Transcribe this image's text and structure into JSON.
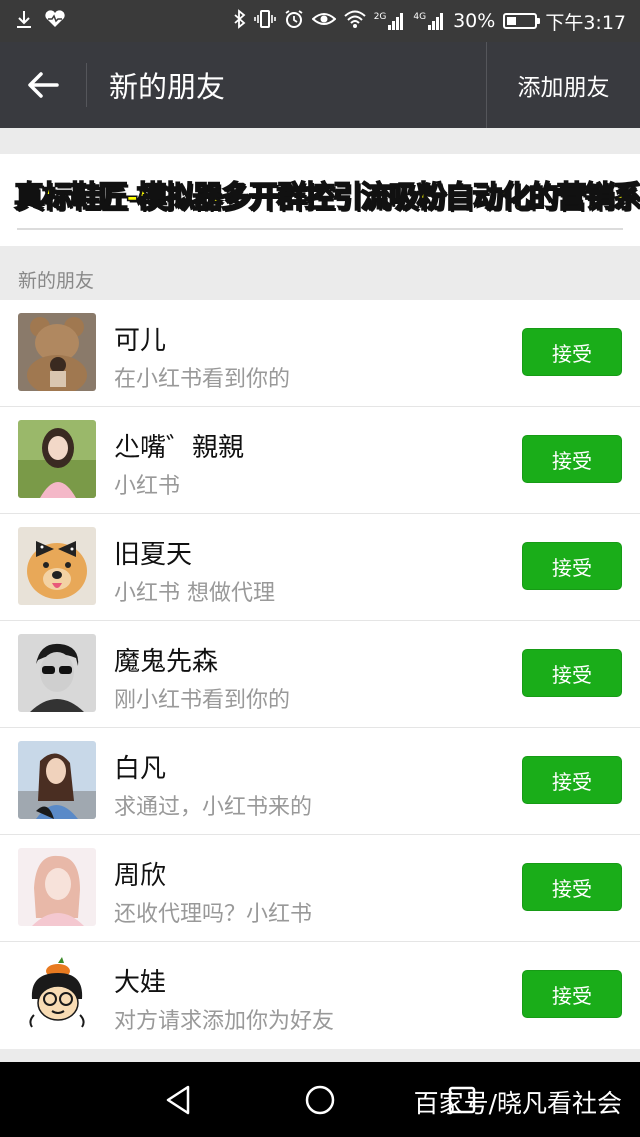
{
  "status_bar": {
    "network_2g": "2G",
    "network_4g": "4G",
    "battery": "30%",
    "battery_level": 0.3,
    "time": "下午3:17"
  },
  "header": {
    "title": "新的朋友",
    "add_friend": "添加朋友"
  },
  "banner": {
    "text": "真标鞋匠-模拟器多开群控引流吸粉自动化的营销系统",
    "text_color": "#ffff00"
  },
  "section": {
    "title": "新的朋友"
  },
  "friends": [
    {
      "name": "可儿",
      "message": "在小红书看到你的",
      "action": "接受"
    },
    {
      "name": "尐嘴゛親親",
      "message": "小红书",
      "action": "接受"
    },
    {
      "name": "旧夏天",
      "message": "小红书 想做代理",
      "action": "接受"
    },
    {
      "name": "魔鬼先森",
      "message": "刚小红书看到你的",
      "action": "接受"
    },
    {
      "name": "白凡",
      "message": "求通过，小红书来的",
      "action": "接受"
    },
    {
      "name": "周欣",
      "message": "还收代理吗？小红书",
      "action": "接受"
    },
    {
      "name": "大娃",
      "message": "对方请求添加你为好友",
      "action": "接受"
    }
  ],
  "watermark": "百家号/晓凡看社会",
  "colors": {
    "accept_green": "#1aad19",
    "title_bar": "#393a3f"
  }
}
